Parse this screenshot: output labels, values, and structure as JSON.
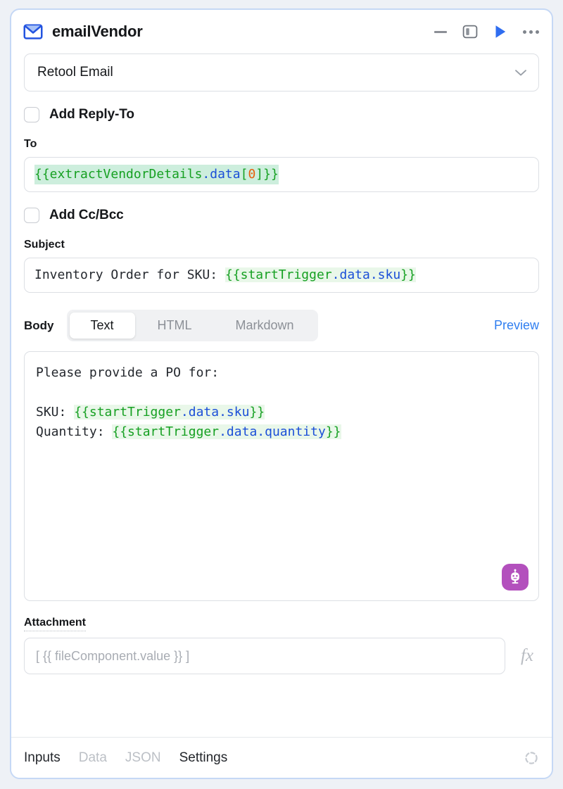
{
  "header": {
    "title": "emailVendor",
    "icon": "envelope-icon",
    "actions": {
      "minimize": "minimize-icon",
      "panel": "panel-toggle-icon",
      "run": "run-icon",
      "more": "more-options-icon"
    }
  },
  "resource": {
    "label": "Retool Email",
    "chevron": "chevron-down-icon"
  },
  "reply_to": {
    "label": "Add Reply-To",
    "checked": false
  },
  "to": {
    "label": "To",
    "expression": "{{extractVendorDetails.data[0]}}",
    "tokens": [
      {
        "t": "{{extractVendorDetails",
        "c": "green"
      },
      {
        "t": ".data",
        "c": "blue"
      },
      {
        "t": "[",
        "c": "green"
      },
      {
        "t": "0",
        "c": "orange"
      },
      {
        "t": "]}}",
        "c": "green"
      }
    ]
  },
  "cc_bcc": {
    "label": "Add Cc/Bcc",
    "checked": false
  },
  "subject": {
    "label": "Subject",
    "value": "Inventory Order for SKU: {{startTrigger.data.sku}}",
    "plain": "Inventory Order for SKU: ",
    "tokens": [
      {
        "t": "{{startTrigger",
        "c": "green"
      },
      {
        "t": ".data.sku",
        "c": "blue"
      },
      {
        "t": "}}",
        "c": "green"
      }
    ]
  },
  "body": {
    "label": "Body",
    "tabs": [
      {
        "label": "Text",
        "active": true
      },
      {
        "label": "HTML",
        "active": false
      },
      {
        "label": "Markdown",
        "active": false
      }
    ],
    "preview_label": "Preview",
    "line1": "Please provide a PO for:",
    "line2": "",
    "sku_prefix": "SKU: ",
    "sku_tokens": [
      {
        "t": "{{startTrigger",
        "c": "green"
      },
      {
        "t": ".data.sku",
        "c": "blue"
      },
      {
        "t": "}}",
        "c": "green"
      }
    ],
    "qty_prefix": "Quantity: ",
    "qty_tokens": [
      {
        "t": "{{startTrigger",
        "c": "green"
      },
      {
        "t": ".data.quantity",
        "c": "blue"
      },
      {
        "t": "}}",
        "c": "green"
      }
    ],
    "ai_button": "ai-assistant-robot-icon"
  },
  "attachment": {
    "label": "Attachment",
    "placeholder": "[ {{ fileComponent.value }} ]",
    "value": "",
    "fx_label": "fx"
  },
  "footer": {
    "tabs": [
      {
        "label": "Inputs",
        "state": "on"
      },
      {
        "label": "Data",
        "state": "off"
      },
      {
        "label": "JSON",
        "state": "off"
      },
      {
        "label": "Settings",
        "state": "on"
      }
    ],
    "spinner": "loading-spinner-icon"
  },
  "colors": {
    "accent_blue": "#2f7ef0",
    "envelope_blue": "#2354e0",
    "ai_purple": "#b350bd",
    "token_green": "#16a022",
    "token_blue": "#1b4fd8",
    "token_orange": "#e8600c",
    "highlight_strong": "#cdeedd",
    "highlight_soft": "#e9f7e9",
    "page_bg": "#eef1f6",
    "card_border": "#c5d8f5"
  }
}
